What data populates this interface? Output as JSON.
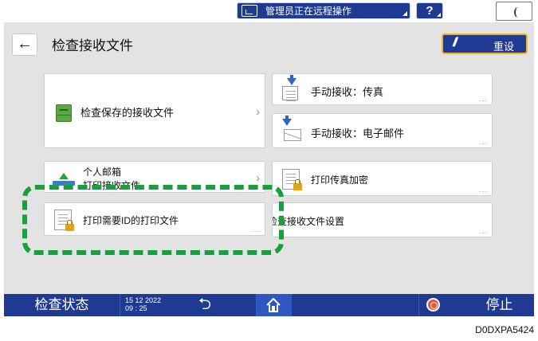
{
  "topbar": {
    "remote_status": "管理员正在远程操作",
    "help_label": "?"
  },
  "header": {
    "back_label": "←",
    "title": "检查接收文件",
    "reset_label": "重设"
  },
  "cards": {
    "stored_files": "检查保存的接收文件",
    "manual_fax": "手动接收：传真",
    "manual_email": "手动接收：电子邮件",
    "personal_box_line1": "个人邮箱",
    "personal_box_line2": "打印接收文件",
    "print_fax_encrypted": "打印传真加密",
    "print_requires_id": "打印需要ID的打印文件",
    "receive_settings": "检查接收文件设置",
    "more": "..."
  },
  "bottombar": {
    "status": "检查状态",
    "date": "15 12 2022",
    "time": "09 : 25",
    "stop": "停止"
  },
  "figure_code": "D0DXPA5424",
  "colors": {
    "brand_blue": "#1f3a93",
    "highlight_green": "#17a03d",
    "reset_border": "#f2b21b"
  }
}
